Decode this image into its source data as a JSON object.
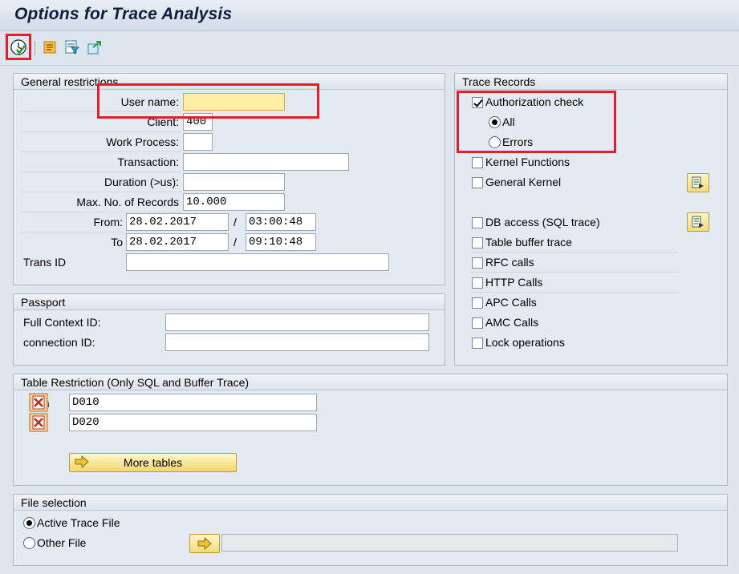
{
  "window": {
    "title": "Options for Trace Analysis"
  },
  "toolbar": {
    "execute": "execute-icon",
    "tools": [
      "trace-settings-icon",
      "filter-icon",
      "export-icon"
    ]
  },
  "general": {
    "title": "General restrictions",
    "user_label": "User name:",
    "user_value": "",
    "client_label": "Client:",
    "client_value": "400",
    "wp_label": "Work Process:",
    "wp_value": "",
    "transaction_label": "Transaction:",
    "transaction_value": "",
    "duration_label": "Duration (>us):",
    "duration_value": "",
    "maxrec_label": "Max. No. of Records",
    "maxrec_value": "10.000",
    "from_label": "From:",
    "from_date": "28.02.2017",
    "from_time": "03:00:48",
    "to_label": "To",
    "to_date": "28.02.2017",
    "to_time": "09:10:48",
    "slash": "/",
    "transid_label": "Trans ID",
    "transid_value": ""
  },
  "passport": {
    "title": "Passport",
    "context_label": "Full Context ID:",
    "connection_label": "connection ID:"
  },
  "trace_records": {
    "title": "Trace Records",
    "auth_check": "Authorization check",
    "auth_checked": true,
    "all": "All",
    "errors": "Errors",
    "kernel_functions": "Kernel Functions",
    "general_kernel": "General Kernel",
    "db_access": "DB access (SQL trace)",
    "table_buffer": "Table buffer trace",
    "rfc": "RFC calls",
    "http": "HTTP Calls",
    "apc": "APC Calls",
    "amc": "AMC Calls",
    "lock": "Lock operations"
  },
  "table_restriction": {
    "title": "Table Restriction (Only SQL and Buffer Trace)",
    "tables": [
      "D010",
      "D020"
    ],
    "more_label": "More tables"
  },
  "file_selection": {
    "title": "File selection",
    "active": "Active Trace File",
    "other": "Other File",
    "other_value": ""
  },
  "colors": {
    "highlight": "#e3202a",
    "field_required": "#fdf0a3"
  }
}
